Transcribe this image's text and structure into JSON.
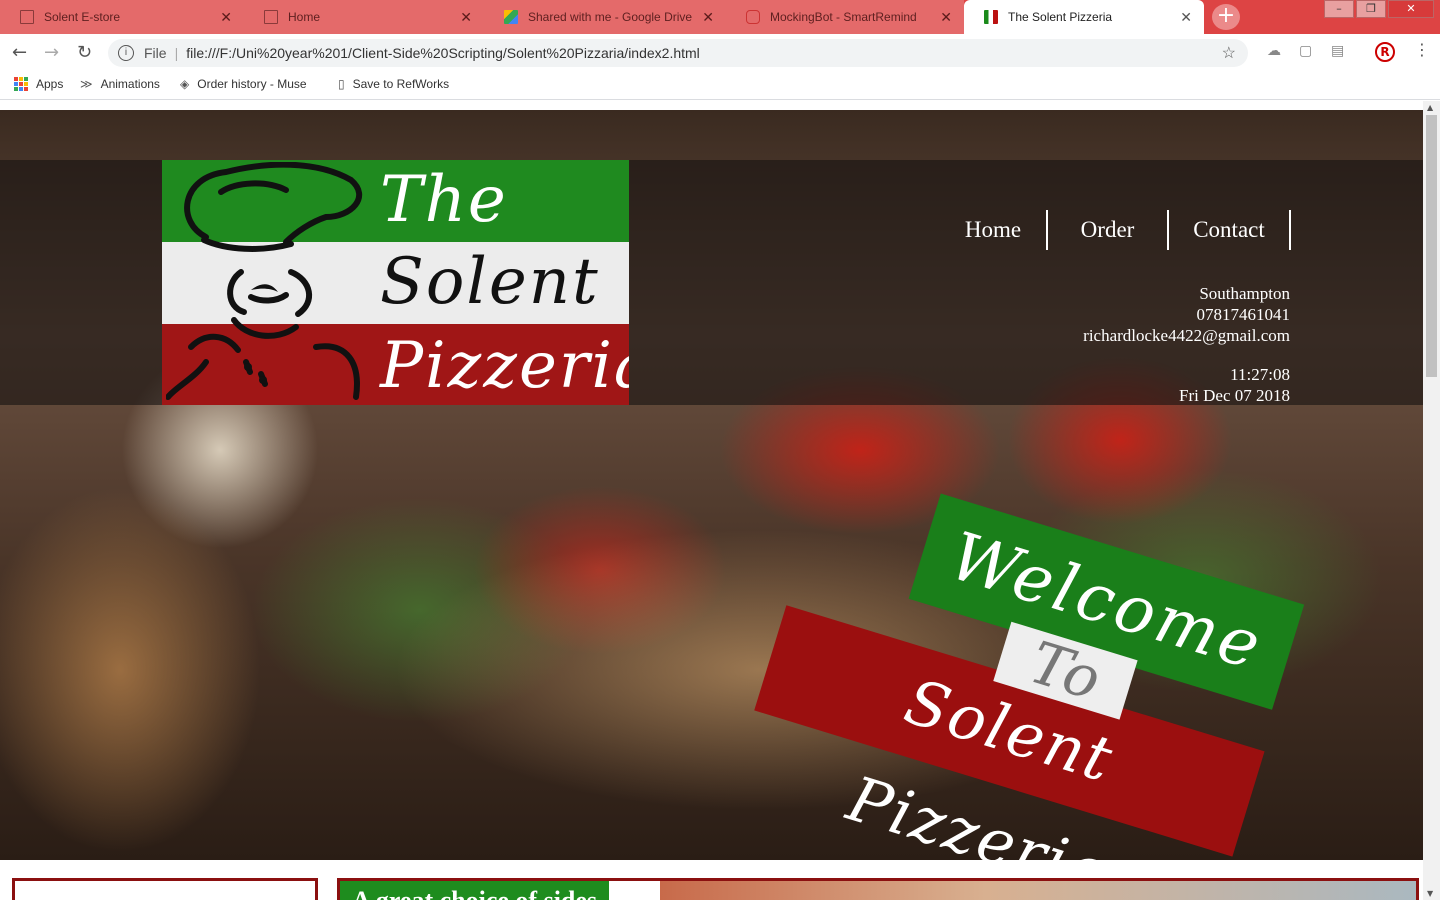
{
  "browser": {
    "tabs": [
      {
        "title": "Solent E-store",
        "active": false
      },
      {
        "title": "Home",
        "active": false
      },
      {
        "title": "Shared with me - Google Drive",
        "active": false
      },
      {
        "title": "MockingBot - SmartRemind",
        "active": false
      },
      {
        "title": "The Solent Pizzeria",
        "active": true
      }
    ],
    "new_tab_label": "+",
    "address": {
      "scheme_label": "File",
      "url": "file:///F:/Uni%20year%201/Client-Side%20Scripting/Solent%20Pizzaria/index2.html"
    },
    "profile_initial": "R",
    "bookmarks": [
      {
        "label": "Apps",
        "icon": "apps-grid-icon"
      },
      {
        "label": "Animations",
        "icon": "animation-icon"
      },
      {
        "label": "Order history - Muse",
        "icon": "muse-icon"
      },
      {
        "label": "Save to RefWorks",
        "icon": "page-icon"
      }
    ]
  },
  "page": {
    "logo": {
      "line1": "The",
      "line2": "Solent",
      "line3": "Pizzeria"
    },
    "nav": {
      "home": "Home",
      "order": "Order",
      "contact": "Contact"
    },
    "contact": {
      "city": "Southampton",
      "phone": "07817461041",
      "email": "richardlocke4422@gmail.com"
    },
    "clock": {
      "time": "11:27:08",
      "date": "Fri Dec 07 2018"
    },
    "welcome": {
      "word1": "Welcome",
      "word2": "To",
      "word3": "Solent Pizzeria"
    },
    "sides_headline": "A great choice of sides"
  },
  "colors": {
    "italian_green": "#1f8a1f",
    "italian_white": "#ececec",
    "italian_red": "#a01616",
    "tabstrip": "#dd4444"
  }
}
